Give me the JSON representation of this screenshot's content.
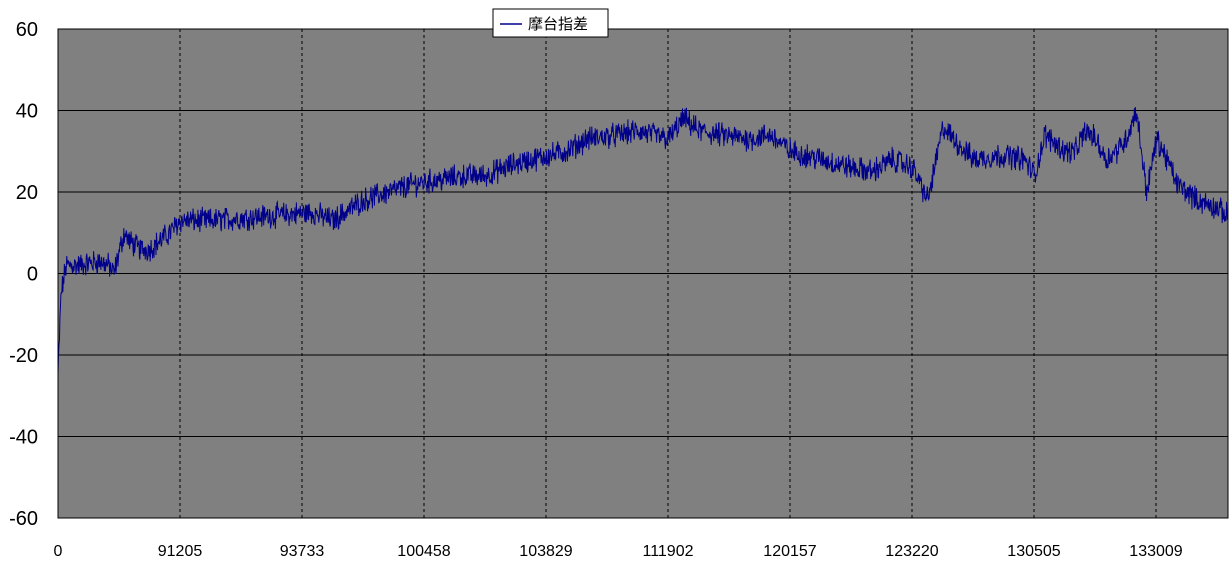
{
  "chart_data": {
    "type": "line",
    "title": "",
    "xlabel": "",
    "ylabel": "",
    "ylim": [
      -60,
      60
    ],
    "yticks": [
      "60",
      "40",
      "20",
      "0",
      "-20",
      "-40",
      "-60"
    ],
    "x_tick_labels": [
      "0",
      "91205",
      "93733",
      "100458",
      "103829",
      "111902",
      "120157",
      "123220",
      "130505",
      "133009"
    ],
    "grid": "horizontal solid, vertical dashed",
    "legend": "top-center",
    "colors": {
      "plot_bg": "#808080",
      "line": "#00008b",
      "grid": "#000000"
    },
    "series": [
      {
        "name": "摩台指差",
        "anchors": [
          [
            0,
            -25
          ],
          [
            0.003,
            -5
          ],
          [
            0.008,
            2
          ],
          [
            0.02,
            2
          ],
          [
            0.04,
            3
          ],
          [
            0.05,
            2
          ],
          [
            0.055,
            0
          ],
          [
            0.06,
            5
          ],
          [
            0.065,
            10
          ],
          [
            0.07,
            8
          ],
          [
            0.08,
            6
          ],
          [
            0.09,
            6
          ],
          [
            0.1,
            8
          ],
          [
            0.11,
            10
          ],
          [
            0.12,
            13
          ],
          [
            0.15,
            13
          ],
          [
            0.2,
            14
          ],
          [
            0.25,
            15
          ],
          [
            0.27,
            13
          ],
          [
            0.3,
            18
          ],
          [
            0.35,
            22
          ],
          [
            0.4,
            24
          ],
          [
            0.42,
            24
          ],
          [
            0.45,
            27
          ],
          [
            0.5,
            30
          ],
          [
            0.52,
            33
          ],
          [
            0.55,
            34
          ],
          [
            0.57,
            35
          ],
          [
            0.6,
            33
          ],
          [
            0.615,
            38
          ],
          [
            0.63,
            35
          ],
          [
            0.65,
            34
          ],
          [
            0.68,
            33
          ],
          [
            0.7,
            34
          ],
          [
            0.72,
            30
          ],
          [
            0.75,
            28
          ],
          [
            0.78,
            26
          ],
          [
            0.8,
            25
          ],
          [
            0.82,
            28
          ],
          [
            0.84,
            26
          ],
          [
            0.855,
            18
          ],
          [
            0.865,
            30
          ],
          [
            0.87,
            36
          ],
          [
            0.88,
            33
          ],
          [
            0.9,
            28
          ],
          [
            0.93,
            29
          ],
          [
            0.95,
            28
          ],
          [
            0.96,
            24
          ],
          [
            0.97,
            34
          ],
          [
            0.98,
            32
          ],
          [
            0.99,
            30
          ],
          [
            1.0,
            30
          ],
          [
            1.01,
            35
          ],
          [
            1.02,
            33
          ],
          [
            1.03,
            28
          ],
          [
            1.04,
            30
          ],
          [
            1.05,
            33
          ],
          [
            1.06,
            40
          ],
          [
            1.07,
            20
          ],
          [
            1.08,
            33
          ],
          [
            1.09,
            28
          ],
          [
            1.1,
            22
          ],
          [
            1.12,
            18
          ],
          [
            1.14,
            16
          ],
          [
            1.15,
            14
          ]
        ],
        "noise_amplitude": 2.5
      }
    ]
  }
}
